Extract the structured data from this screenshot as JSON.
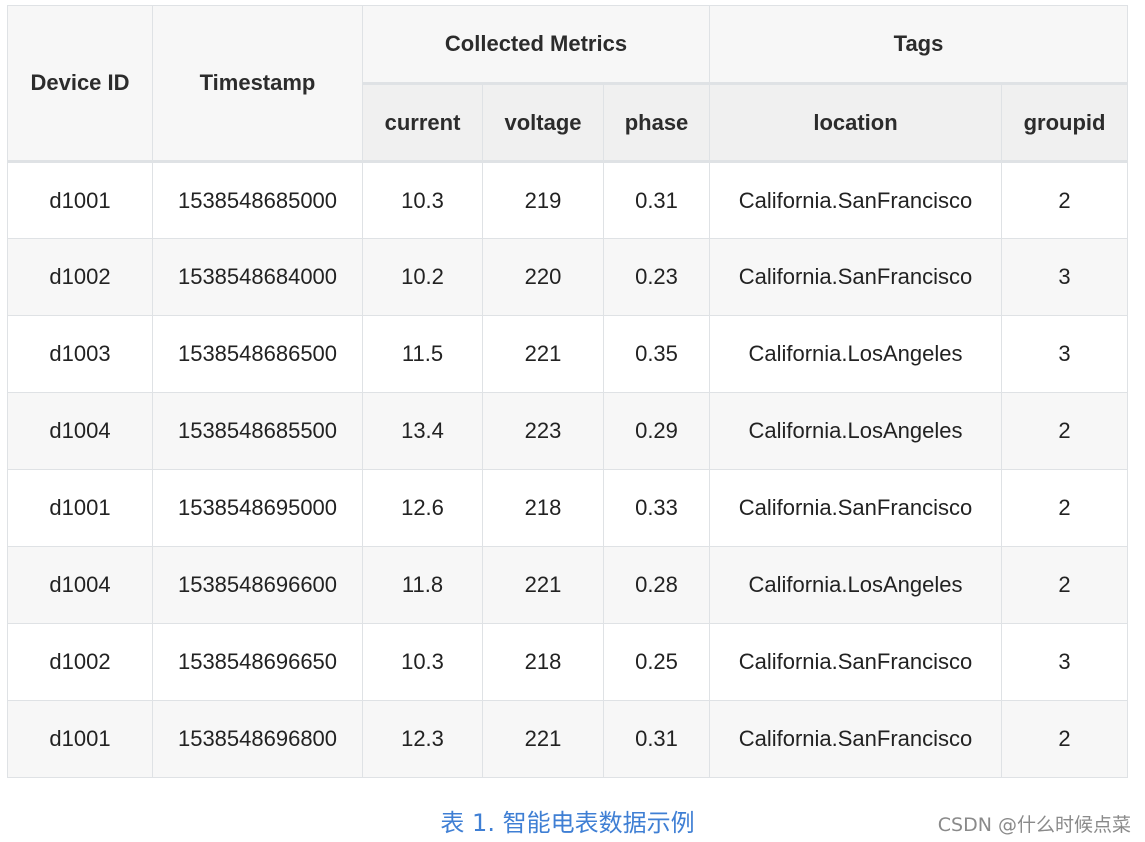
{
  "table": {
    "headers": {
      "device_id": "Device ID",
      "timestamp": "Timestamp",
      "collected_metrics": "Collected Metrics",
      "tags": "Tags",
      "current": "current",
      "voltage": "voltage",
      "phase": "phase",
      "location": "location",
      "groupid": "groupid"
    },
    "rows": [
      {
        "device_id": "d1001",
        "timestamp": "1538548685000",
        "current": "10.3",
        "voltage": "219",
        "phase": "0.31",
        "location": "California.SanFrancisco",
        "groupid": "2"
      },
      {
        "device_id": "d1002",
        "timestamp": "1538548684000",
        "current": "10.2",
        "voltage": "220",
        "phase": "0.23",
        "location": "California.SanFrancisco",
        "groupid": "3"
      },
      {
        "device_id": "d1003",
        "timestamp": "1538548686500",
        "current": "11.5",
        "voltage": "221",
        "phase": "0.35",
        "location": "California.LosAngeles",
        "groupid": "3"
      },
      {
        "device_id": "d1004",
        "timestamp": "1538548685500",
        "current": "13.4",
        "voltage": "223",
        "phase": "0.29",
        "location": "California.LosAngeles",
        "groupid": "2"
      },
      {
        "device_id": "d1001",
        "timestamp": "1538548695000",
        "current": "12.6",
        "voltage": "218",
        "phase": "0.33",
        "location": "California.SanFrancisco",
        "groupid": "2"
      },
      {
        "device_id": "d1004",
        "timestamp": "1538548696600",
        "current": "11.8",
        "voltage": "221",
        "phase": "0.28",
        "location": "California.LosAngeles",
        "groupid": "2"
      },
      {
        "device_id": "d1002",
        "timestamp": "1538548696650",
        "current": "10.3",
        "voltage": "218",
        "phase": "0.25",
        "location": "California.SanFrancisco",
        "groupid": "3"
      },
      {
        "device_id": "d1001",
        "timestamp": "1538548696800",
        "current": "12.3",
        "voltage": "221",
        "phase": "0.31",
        "location": "California.SanFrancisco",
        "groupid": "2"
      }
    ]
  },
  "caption": "表 1. 智能电表数据示例",
  "watermark": "CSDN @什么时候点菜",
  "colors": {
    "caption": "#3f7fd4",
    "header_bg": "#f7f7f7",
    "subheader_bg": "#f0f0f0",
    "stripe_bg": "#f7f7f7",
    "border": "#dfe2e5",
    "watermark": "#8a8a8a"
  }
}
